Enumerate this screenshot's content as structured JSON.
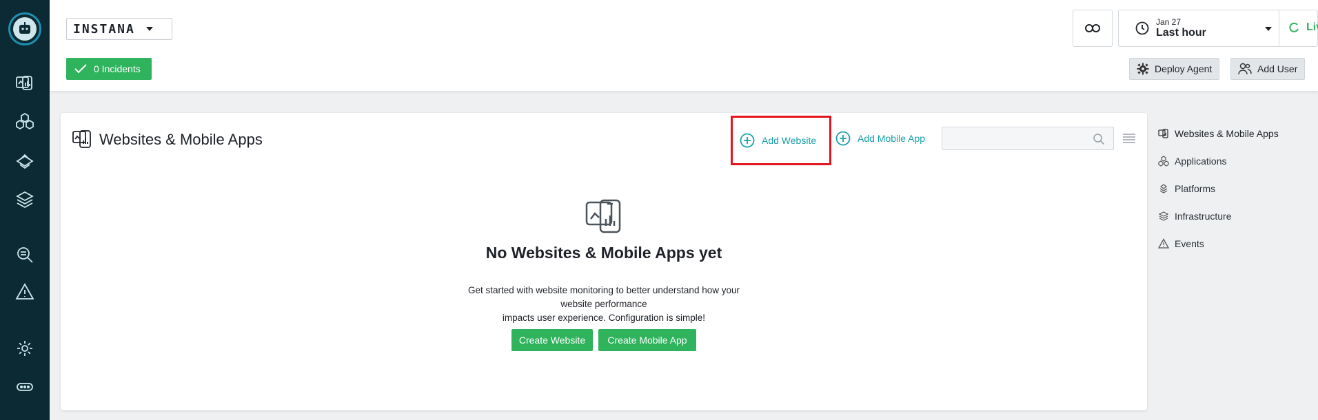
{
  "brand": {
    "name": "INSTANA"
  },
  "incidents": {
    "label": "0 Incidents"
  },
  "time": {
    "date": "Jan 27",
    "range": "Last hour",
    "live_label": "Live"
  },
  "actions": {
    "deploy_agent": "Deploy Agent",
    "add_user": "Add User"
  },
  "rail": {
    "items": [
      "websites-mobile-apps",
      "applications",
      "platforms",
      "infrastructure",
      "analytics",
      "events",
      "settings",
      "more"
    ]
  },
  "main": {
    "title": "Websites & Mobile Apps",
    "add_website": "Add Website",
    "add_mobile_app": "Add Mobile App",
    "search_placeholder": "",
    "empty_title": "No Websites & Mobile Apps yet",
    "empty_line1": "Get started with website monitoring to better understand how your website performance",
    "empty_line2": "impacts user experience. Configuration is simple!",
    "create_website": "Create Website",
    "create_mobile_app": "Create Mobile App"
  },
  "sidebar": {
    "items": [
      {
        "label": "Websites & Mobile Apps"
      },
      {
        "label": "Applications"
      },
      {
        "label": "Platforms"
      },
      {
        "label": "Infrastructure"
      },
      {
        "label": "Events"
      }
    ]
  },
  "colors": {
    "rail": "#0b2a33",
    "accent_green": "#2fb35d",
    "link_teal": "#17a1a8",
    "highlight_red": "#e3141b"
  }
}
